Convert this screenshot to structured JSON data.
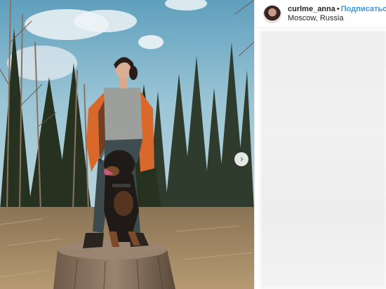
{
  "post": {
    "username": "curlme_anna",
    "separator": "•",
    "follow_label": "Подписаться",
    "location": "Moscow, Russia"
  },
  "icons": {
    "next": "chevron-right-icon"
  },
  "colors": {
    "follow_link": "#3897f0",
    "text": "#262626",
    "border": "#e6e6e6"
  }
}
